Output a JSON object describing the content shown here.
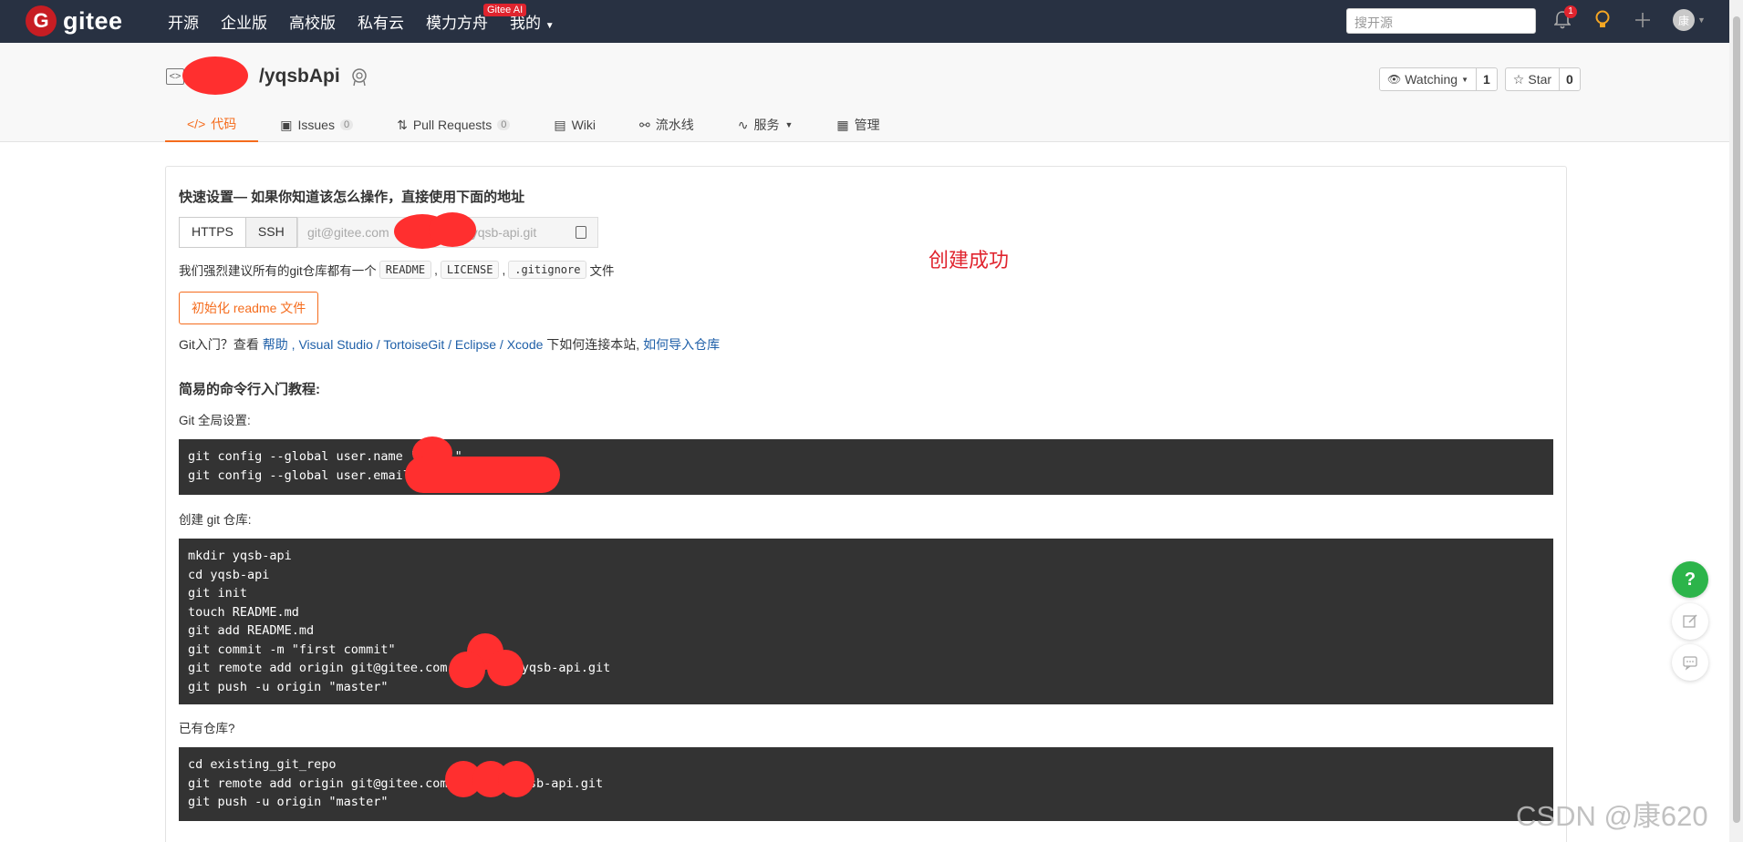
{
  "nav": {
    "logo_text": "gitee",
    "logo_mark": "G",
    "links": [
      "开源",
      "企业版",
      "高校版",
      "私有云",
      "模力方舟",
      "我的"
    ],
    "ai_badge": "Gitee AI",
    "search_placeholder": "搜开源",
    "notification_count": "1"
  },
  "repo": {
    "name": "/yqsbApi",
    "watch_label": "Watching",
    "watch_count": "1",
    "star_label": "Star",
    "star_count": "0"
  },
  "tabs": [
    {
      "label": "代码",
      "count": ""
    },
    {
      "label": "Issues",
      "count": "0"
    },
    {
      "label": "Pull Requests",
      "count": "0"
    },
    {
      "label": "Wiki",
      "count": ""
    },
    {
      "label": "流水线",
      "count": ""
    },
    {
      "label": "服务",
      "count": ""
    },
    {
      "label": "管理",
      "count": ""
    }
  ],
  "quick": {
    "title": "快速设置— 如果你知道该怎么操作，直接使用下面的地址",
    "https": "HTTPS",
    "ssh": "SSH",
    "url_prefix": "git@gitee.com",
    "url_suffix": "yqsb-api.git",
    "recommend_pre": "我们强烈建议所有的git仓库都有一个",
    "readme": "README",
    "license": "LICENSE",
    "gitignore": ".gitignore",
    "recommend_post": "文件",
    "sep": ",",
    "init_button": "初始化 readme 文件",
    "help_pre": "Git入门？查看",
    "help_link": "帮助",
    "help_tools": ", Visual Studio / TortoiseGit / Eclipse / Xcode",
    "help_mid": "下如何连接本站,",
    "help_import": "如何导入仓库"
  },
  "success_text": "创建成功",
  "tutorial": {
    "heading": "简易的命令行入门教程:",
    "global_label": "Git 全局设置:",
    "global_lines": [
      "git config --global user.name \"     \"",
      "git config --global user.email"
    ],
    "create_label": "创建 git 仓库:",
    "create_lines": [
      "mkdir yqsb-api",
      "cd yqsb-api",
      "git init",
      "touch README.md",
      "git add README.md",
      "git commit -m \"first commit\"",
      "git remote add origin git@gitee.com:       g/yqsb-api.git",
      "git push -u origin \"master\""
    ],
    "existing_label": "已有仓库?",
    "existing_lines": [
      "cd existing_git_repo",
      "git remote add origin git@gitee.com:       /yqsb-api.git",
      "git push -u origin \"master\""
    ]
  },
  "watermark": "CSDN @康620",
  "colors": {
    "accent": "#f56c1d",
    "nav_bg": "#283142",
    "brand": "#c71d23",
    "help_green": "#2cb44a"
  }
}
